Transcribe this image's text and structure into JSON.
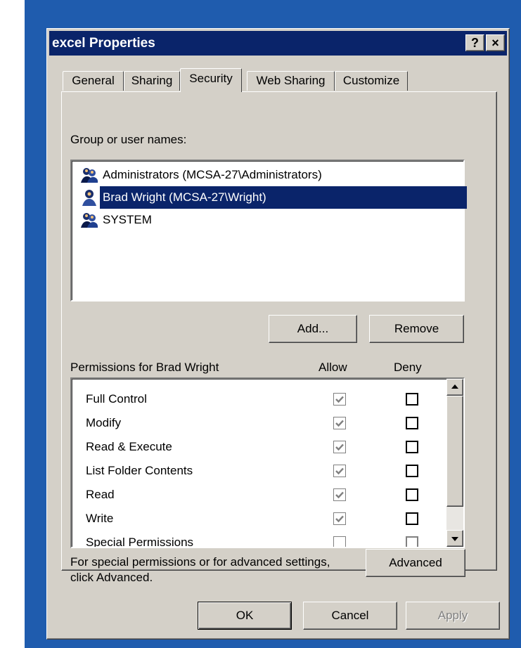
{
  "window": {
    "title": "excel Properties",
    "help_glyph": "?",
    "close_glyph": "×"
  },
  "tabs": [
    {
      "label": "General",
      "active": false
    },
    {
      "label": "Sharing",
      "active": false
    },
    {
      "label": "Security",
      "active": true
    },
    {
      "label": "Web Sharing",
      "active": false
    },
    {
      "label": "Customize",
      "active": false
    }
  ],
  "security": {
    "group_label": "Group or user names:",
    "users": [
      {
        "name": "Administrators (MCSA-27\\Administrators)",
        "icon": "user-group-icon",
        "selected": false
      },
      {
        "name": "Brad Wright (MCSA-27\\Wright)",
        "icon": "user-icon",
        "selected": true
      },
      {
        "name": "SYSTEM",
        "icon": "user-group-icon",
        "selected": false
      }
    ],
    "add_label": "Add...",
    "remove_label": "Remove",
    "permissions_label": "Permissions for Brad Wright",
    "allow_label": "Allow",
    "deny_label": "Deny",
    "permissions": [
      {
        "name": "Full Control",
        "allow": true,
        "deny": false
      },
      {
        "name": "Modify",
        "allow": true,
        "deny": false
      },
      {
        "name": "Read & Execute",
        "allow": true,
        "deny": false
      },
      {
        "name": "List Folder Contents",
        "allow": true,
        "deny": false
      },
      {
        "name": "Read",
        "allow": true,
        "deny": false
      },
      {
        "name": "Write",
        "allow": true,
        "deny": false
      },
      {
        "name": "Special Permissions",
        "allow": false,
        "deny": false
      }
    ],
    "advanced_hint_line1": "For special permissions or for advanced settings,",
    "advanced_hint_line2": "click Advanced.",
    "advanced_label": "Advanced"
  },
  "footer": {
    "ok_label": "OK",
    "cancel_label": "Cancel",
    "apply_label": "Apply"
  },
  "colors": {
    "titlebar": "#0a246a",
    "face": "#d4d0c8",
    "desktop": "#1f5cae",
    "selection": "#0a246a"
  }
}
